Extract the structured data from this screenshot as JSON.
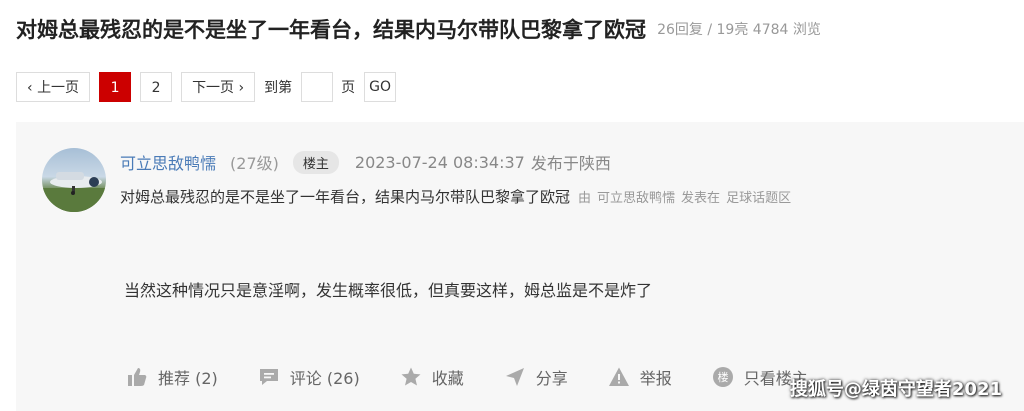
{
  "thread": {
    "title": "对姆总最残忍的是不是坐了一年看台，结果内马尔带队巴黎拿了欧冠",
    "stats": "26回复 / 19亮 4784 浏览"
  },
  "pagination": {
    "prev": "上一页",
    "pages": [
      "1",
      "2"
    ],
    "current": "1",
    "next": "下一页",
    "goto_prefix": "到第",
    "goto_suffix": "页",
    "go": "GO",
    "page_input_value": ""
  },
  "post": {
    "username": "可立思敌鸭懦",
    "level": "(27级)",
    "badge": "楼主",
    "datetime": "2023-07-24 08:34:37",
    "location": "发布于陕西",
    "subtitle": "对姆总最残忍的是不是坐了一年看台，结果内马尔带队巴黎拿了欧冠",
    "by_prefix": "由",
    "by_user": "可立思敌鸭懦",
    "posted_in": "发表在",
    "forum": "足球话题区",
    "content": "当然这种情况只是意淫啊，发生概率很低，但真要这样，姆总监是不是炸了"
  },
  "actions": {
    "recommend": "推荐 (2)",
    "comment": "评论 (26)",
    "favorite": "收藏",
    "share": "分享",
    "report": "举报",
    "only_op": "只看楼主",
    "only_op_icon_char": "楼"
  },
  "watermark": "搜狐号@绿茵守望者2021",
  "colors": {
    "accent": "#cc0000",
    "username": "#4a7bb7",
    "post_bg": "#f7f7f7"
  },
  "icons": [
    "chevron-left-icon",
    "chevron-right-icon",
    "thumbs-up-icon",
    "comment-icon",
    "star-icon",
    "share-arrow-icon",
    "warning-icon",
    "only-op-icon"
  ]
}
